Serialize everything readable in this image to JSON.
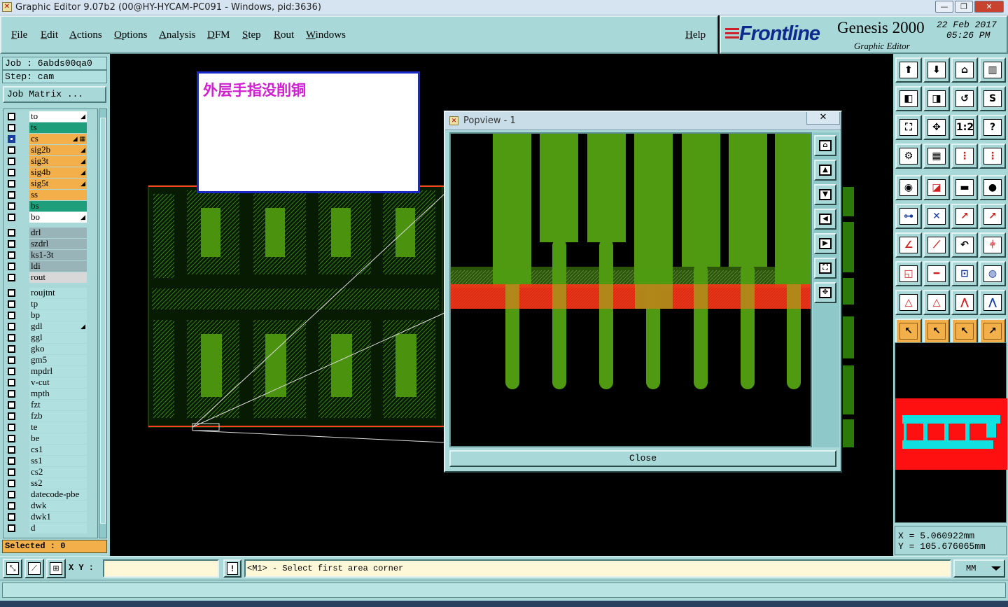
{
  "window": {
    "title": "Graphic Editor 9.07b2 (00@HY-HYCAM-PC091 - Windows, pid:3636)",
    "buttons": [
      "—",
      "❐",
      "✕"
    ]
  },
  "menu": {
    "items": [
      "File",
      "Edit",
      "Actions",
      "Options",
      "Analysis",
      "DFM",
      "Step",
      "Rout",
      "Windows"
    ],
    "help": "Help"
  },
  "brand": {
    "logo": "Frontline",
    "product": "Genesis 2000",
    "subtitle": "Graphic Editor",
    "date": "22 Feb 2017",
    "time": "05:26 PM"
  },
  "job": {
    "job_label": "Job : 6abds00qa0",
    "step_label": "Step: cam",
    "matrix_button": "Job Matrix ..."
  },
  "layers": {
    "group1": [
      {
        "name": "to",
        "color": "#ffffff",
        "mark": "◢",
        "on": false
      },
      {
        "name": "ts",
        "color": "#1e9e7a",
        "mark": "",
        "on": false
      },
      {
        "name": "cs",
        "color": "#f3b04a",
        "mark": "◢ ▦",
        "on": true
      },
      {
        "name": "sig2b",
        "color": "#f3b04a",
        "mark": "◢",
        "on": false
      },
      {
        "name": "sig3t",
        "color": "#f3b04a",
        "mark": "◢",
        "on": false
      },
      {
        "name": "sig4b",
        "color": "#f3b04a",
        "mark": "◢",
        "on": false
      },
      {
        "name": "sig5t",
        "color": "#f3b04a",
        "mark": "◢",
        "on": false
      },
      {
        "name": "ss",
        "color": "#f3b04a",
        "mark": "",
        "on": false
      },
      {
        "name": "bs",
        "color": "#1e9e7a",
        "mark": "",
        "on": false
      },
      {
        "name": "bo",
        "color": "#ffffff",
        "mark": "◢",
        "on": false
      }
    ],
    "group2": [
      {
        "name": "drl",
        "color": "#98b4b8",
        "mark": "",
        "on": false
      },
      {
        "name": "szdrl",
        "color": "#98b4b8",
        "mark": "",
        "on": false
      },
      {
        "name": "ks1-3t",
        "color": "#98b4b8",
        "mark": "",
        "on": false
      },
      {
        "name": "ldi",
        "color": "#98b4b8",
        "mark": "",
        "on": false
      },
      {
        "name": "rout",
        "color": "#d8d8d8",
        "mark": "",
        "on": false
      }
    ],
    "group3": [
      {
        "name": "roujtnt",
        "color": "#b0e0e0",
        "mark": "",
        "on": false
      },
      {
        "name": "tp",
        "color": "#b0e0e0",
        "mark": "",
        "on": false
      },
      {
        "name": "bp",
        "color": "#b0e0e0",
        "mark": "",
        "on": false
      },
      {
        "name": "gdl",
        "color": "#b0e0e0",
        "mark": "◢",
        "on": false
      },
      {
        "name": "ggl",
        "color": "#b0e0e0",
        "mark": "",
        "on": false
      },
      {
        "name": "gko",
        "color": "#b0e0e0",
        "mark": "",
        "on": false
      },
      {
        "name": "gm5",
        "color": "#b0e0e0",
        "mark": "",
        "on": false
      },
      {
        "name": "mpdrl",
        "color": "#b0e0e0",
        "mark": "",
        "on": false
      },
      {
        "name": "v-cut",
        "color": "#b0e0e0",
        "mark": "",
        "on": false
      },
      {
        "name": "mpth",
        "color": "#b0e0e0",
        "mark": "",
        "on": false
      },
      {
        "name": "fzt",
        "color": "#b0e0e0",
        "mark": "",
        "on": false
      },
      {
        "name": "fzb",
        "color": "#b0e0e0",
        "mark": "",
        "on": false
      },
      {
        "name": "te",
        "color": "#b0e0e0",
        "mark": "",
        "on": false
      },
      {
        "name": "be",
        "color": "#b0e0e0",
        "mark": "",
        "on": false
      },
      {
        "name": "cs1",
        "color": "#b0e0e0",
        "mark": "",
        "on": false
      },
      {
        "name": "ss1",
        "color": "#b0e0e0",
        "mark": "",
        "on": false
      },
      {
        "name": "cs2",
        "color": "#b0e0e0",
        "mark": "",
        "on": false
      },
      {
        "name": "ss2",
        "color": "#b0e0e0",
        "mark": "",
        "on": false
      },
      {
        "name": "datecode-pbe",
        "color": "#b0e0e0",
        "mark": "",
        "on": false
      },
      {
        "name": "dwk",
        "color": "#b0e0e0",
        "mark": "",
        "on": false
      },
      {
        "name": "dwk1",
        "color": "#b0e0e0",
        "mark": "",
        "on": false
      },
      {
        "name": "d",
        "color": "#b0e0e0",
        "mark": "",
        "on": false
      }
    ]
  },
  "selected": "Selected : 0",
  "note": {
    "text": "外层手指没削铜"
  },
  "popview": {
    "title": "Popview - 1",
    "close_x": "✕",
    "close_button": "Close"
  },
  "tools": [
    {
      "name": "zoom-home-icon",
      "glyph": "⬆",
      "style": ""
    },
    {
      "name": "zoom-down-icon",
      "glyph": "⬇",
      "style": ""
    },
    {
      "name": "home-icon",
      "glyph": "⌂",
      "style": ""
    },
    {
      "name": "split-view-icon",
      "glyph": "▥",
      "style": ""
    },
    {
      "name": "pan-left-icon",
      "glyph": "◧",
      "style": ""
    },
    {
      "name": "pan-right-icon",
      "glyph": "◨",
      "style": ""
    },
    {
      "name": "rotate-icon",
      "glyph": "↺",
      "style": ""
    },
    {
      "name": "redraw-icon",
      "glyph": "S",
      "style": ""
    },
    {
      "name": "zoom-fit-icon",
      "glyph": "⛶",
      "style": ""
    },
    {
      "name": "zoom-center-icon",
      "glyph": "✥",
      "style": ""
    },
    {
      "name": "scale-icon",
      "glyph": "1:2",
      "style": ""
    },
    {
      "name": "help-icon",
      "glyph": "?",
      "style": ""
    },
    {
      "name": "measure-icon",
      "glyph": "⚙",
      "style": ""
    },
    {
      "name": "grid-icon",
      "glyph": "▦",
      "style": ""
    },
    {
      "name": "layers-icon",
      "glyph": "⋮",
      "style": "red"
    },
    {
      "name": "layers-alt-icon",
      "glyph": "⋮",
      "style": "red"
    },
    {
      "name": "select-pad-icon",
      "glyph": "◉",
      "style": ""
    },
    {
      "name": "select-line-icon",
      "glyph": "◪",
      "style": "red"
    },
    {
      "name": "ruler-icon",
      "glyph": "▬",
      "style": ""
    },
    {
      "name": "circle-icon",
      "glyph": "●",
      "style": ""
    },
    {
      "name": "net-icon",
      "glyph": "⊶",
      "style": "blue"
    },
    {
      "name": "cross-icon",
      "glyph": "✕",
      "style": "blue"
    },
    {
      "name": "connect-icon",
      "glyph": "↗",
      "style": "red"
    },
    {
      "name": "connect-alt-icon",
      "glyph": "↗",
      "style": "red"
    },
    {
      "name": "angle-icon",
      "glyph": "∠",
      "style": "red"
    },
    {
      "name": "diagonal-icon",
      "glyph": "⟋",
      "style": "red"
    },
    {
      "name": "undo-icon",
      "glyph": "↶",
      "style": ""
    },
    {
      "name": "flip-icon",
      "glyph": "⫩",
      "style": "red"
    },
    {
      "name": "snap-icon",
      "glyph": "◱",
      "style": "red"
    },
    {
      "name": "line-icon",
      "glyph": "━",
      "style": "red"
    },
    {
      "name": "box-select-icon",
      "glyph": "⊡",
      "style": "blue"
    },
    {
      "name": "shapes-icon",
      "glyph": "◍",
      "style": "blue"
    },
    {
      "name": "triangle-icon",
      "glyph": "△",
      "style": "red"
    },
    {
      "name": "triangle-alt-icon",
      "glyph": "△",
      "style": "red"
    },
    {
      "name": "arch-icon",
      "glyph": "⋀",
      "style": "red"
    },
    {
      "name": "arch-alt-icon",
      "glyph": "⋀",
      "style": "blue"
    },
    {
      "name": "pointer-icon",
      "glyph": "↖",
      "style": "orange"
    },
    {
      "name": "pointer-box-icon",
      "glyph": "↖",
      "style": "orange"
    },
    {
      "name": "pointer-circle-icon",
      "glyph": "↖",
      "style": "orange"
    },
    {
      "name": "pointer-path-icon",
      "glyph": "↗",
      "style": "orange"
    }
  ],
  "coords": {
    "x": "X = 5.060922mm",
    "y": "Y = 105.676065mm"
  },
  "bottom": {
    "xy_label": "X Y :",
    "xy_value": "",
    "warn": "!",
    "status": "<M1> - Select first area corner",
    "units": "MM"
  },
  "colors": {
    "panel": "#a8d8d8",
    "copper": "#4f9a10",
    "highlight": "#ff3a1a",
    "note_border": "#1a28c8",
    "note_text": "#d020d0"
  }
}
